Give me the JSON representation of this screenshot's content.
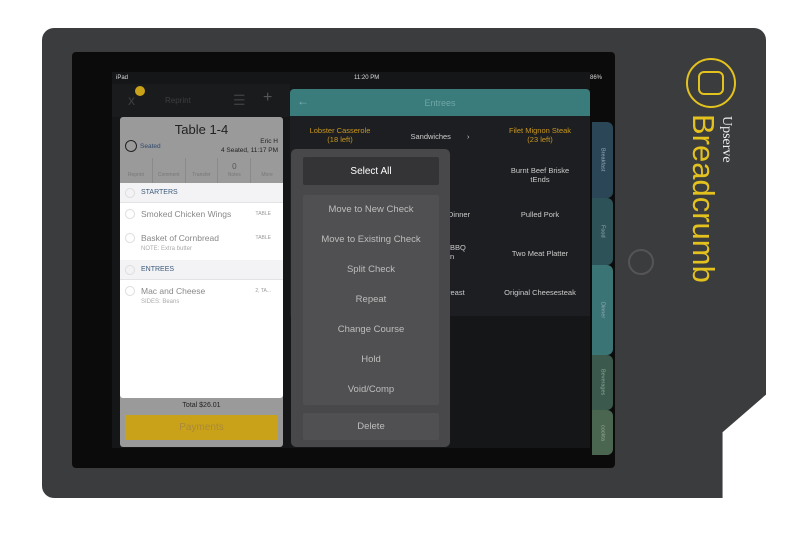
{
  "brand": {
    "company": "Upserve",
    "product": "Breadcrumb",
    "color": "#e4c21e"
  },
  "status_bar": {
    "device": "iPad",
    "time": "11:20 PM",
    "battery": "86%"
  },
  "toolbar": {
    "close_icon": "x",
    "reprint_label": "Reprint",
    "list_icon": "list",
    "add_icon": "+"
  },
  "check": {
    "title": "Table 1-4",
    "status": "Seated",
    "server": "Eric H",
    "seated_info": "4 Seated, 11:17 PM",
    "actions": [
      "Reprint",
      "Comment",
      "Transfer",
      "Notes",
      "More"
    ],
    "notes_count": "0",
    "sections": [
      {
        "name": "STARTERS",
        "items": [
          {
            "name": "Smoked Chicken Wings",
            "tag": "TABLE"
          },
          {
            "name": "Basket of Cornbread",
            "tag": "TABLE",
            "note": "NOTE: Extra butter"
          }
        ]
      },
      {
        "name": "ENTREES",
        "items": [
          {
            "name": "Mac and Cheese",
            "tag": "2, TA...",
            "note": "SIDES: Beans"
          }
        ]
      }
    ],
    "total": "Total $26.01",
    "payments_label": "Payments",
    "accent": "#c9a21a"
  },
  "menu": {
    "title": "Entrees",
    "header_color": "#3a7b7b",
    "cells": [
      {
        "text": "Lobster Casserole",
        "sub": "(18 left)"
      },
      {
        "text": "Sandwiches"
      },
      {
        "text": "Filet Mignon Steak",
        "sub": "(23 left)"
      },
      {
        "text": "ket"
      },
      {
        "text": "Burnt Beef Briske",
        "sub": "tEnds"
      },
      {
        "text": "Dinner"
      },
      {
        "text": "Pulled Pork"
      },
      {
        "text": "BBQ",
        "sub": "n"
      },
      {
        "text": "Two Meat Platter"
      },
      {
        "text": "reast"
      },
      {
        "text": "Original Cheesesteak"
      }
    ],
    "tabs": [
      "Breakfast",
      "Food",
      "Dinner",
      "Beverages",
      "cockta"
    ]
  },
  "popup": {
    "select_all": "Select All",
    "options": [
      "Move to New Check",
      "Move to Existing Check",
      "Split Check",
      "Repeat",
      "Change Course",
      "Hold",
      "Void/Comp"
    ],
    "delete": "Delete"
  }
}
